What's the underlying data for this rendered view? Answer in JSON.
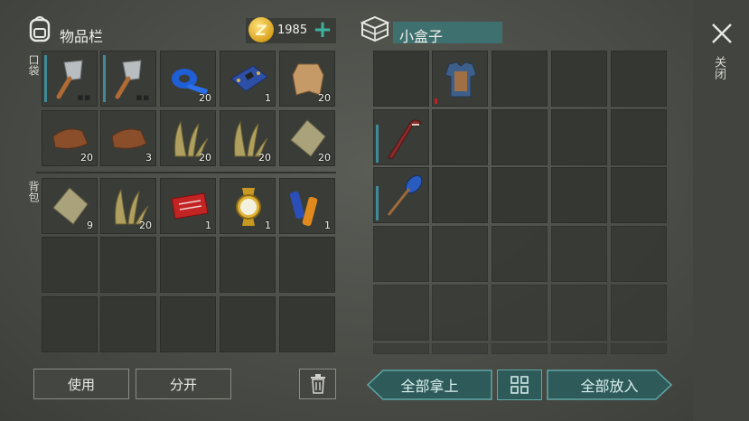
{
  "inventory": {
    "title": "物品栏",
    "currency_amount": "1985",
    "currency_symbol": "Z",
    "pocket_label": "口袋",
    "backpack_label": "背包",
    "pocket_items": [
      {
        "icon": "cleaver-icon",
        "count": ""
      },
      {
        "icon": "cleaver-icon",
        "count": ""
      },
      {
        "icon": "duct-tape-icon",
        "count": "20"
      },
      {
        "icon": "circuit-board-icon",
        "count": "1"
      },
      {
        "icon": "animal-hide-icon",
        "count": "20"
      },
      {
        "icon": "leather-icon",
        "count": "20"
      },
      {
        "icon": "leather-icon",
        "count": "3"
      },
      {
        "icon": "plant-fiber-icon",
        "count": "20"
      },
      {
        "icon": "plant-fiber-icon",
        "count": "20"
      },
      {
        "icon": "cloth-icon",
        "count": "20"
      }
    ],
    "backpack_items": [
      {
        "icon": "cloth-icon",
        "count": "9"
      },
      {
        "icon": "plant-fiber-icon",
        "count": "20"
      },
      {
        "icon": "combat-coupon-icon",
        "count": "1"
      },
      {
        "icon": "gold-watch-icon",
        "count": "1"
      },
      {
        "icon": "batteries-icon",
        "count": "1"
      }
    ],
    "use_button": "使用",
    "split_button": "分开"
  },
  "container": {
    "title": "小盒子",
    "items": [
      {
        "icon": "chest-armor-icon"
      },
      {
        "icon": "hockey-stick-icon"
      },
      {
        "icon": "paddle-icon"
      }
    ],
    "take_all_button": "全部拿上",
    "put_all_button": "全部放入"
  },
  "close_label": "关闭",
  "colors": {
    "accent_teal": "#3f8a98",
    "title_bar": "#3f7070",
    "button_teal": "#5fa8a6"
  }
}
